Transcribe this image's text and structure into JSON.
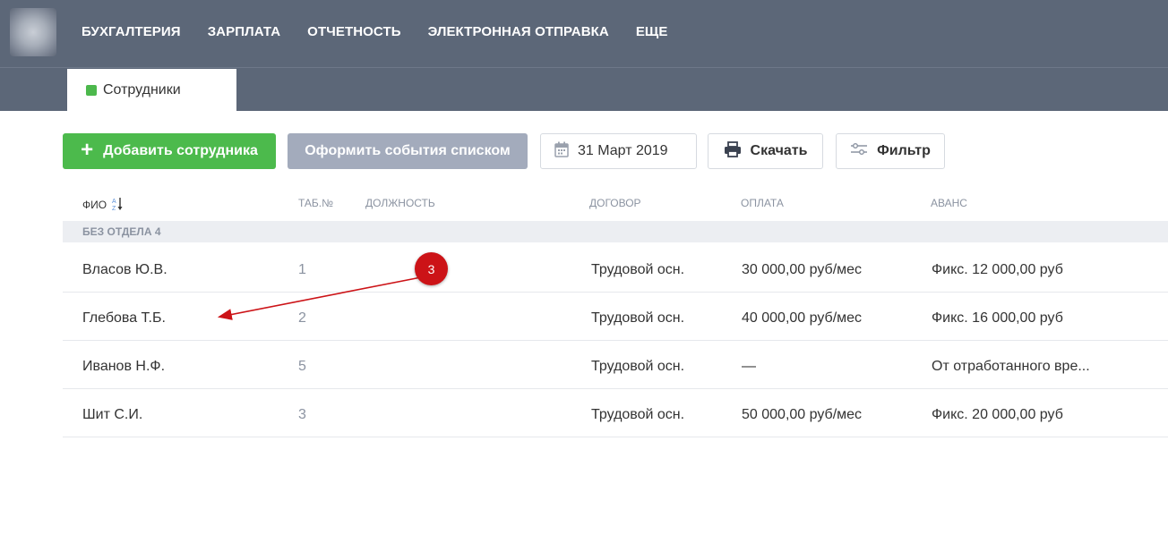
{
  "nav": {
    "items": [
      "БУХГАЛТЕРИЯ",
      "ЗАРПЛАТА",
      "ОТЧЕТНОСТЬ",
      "ЭЛЕКТРОННАЯ ОТПРАВКА",
      "ЕЩЕ"
    ]
  },
  "tab": {
    "label": "Сотрудники"
  },
  "toolbar": {
    "add_label": "Добавить сотрудника",
    "events_label": "Оформить события списком",
    "date_label": "31 Март 2019",
    "print_label": "Скачать",
    "filter_label": "Фильтр"
  },
  "columns": {
    "fio": "ФИО",
    "tab": "ТАБ.№",
    "position": "ДОЛЖНОСТЬ",
    "contract": "ДОГОВОР",
    "pay": "ОПЛАТА",
    "advance": "АВАНС"
  },
  "group": {
    "label": "БЕЗ ОТДЕЛА 4"
  },
  "rows": [
    {
      "name": "Власов Ю.В.",
      "tab": "1",
      "contract": "Трудовой осн.",
      "pay": "30 000,00 руб/мес",
      "advance": "Фикс. 12 000,00 руб"
    },
    {
      "name": "Глебова Т.Б.",
      "tab": "2",
      "contract": "Трудовой осн.",
      "pay": "40 000,00 руб/мес",
      "advance": "Фикс. 16 000,00 руб"
    },
    {
      "name": "Иванов Н.Ф.",
      "tab": "5",
      "contract": "Трудовой осн.",
      "pay": "—",
      "advance": "От отработанного вре..."
    },
    {
      "name": "Шит С.И.",
      "tab": "3",
      "contract": "Трудовой осн.",
      "pay": "50 000,00 руб/мес",
      "advance": "Фикс. 20 000,00 руб"
    }
  ],
  "annotation": {
    "badge": "3",
    "color": "#cc1317"
  },
  "colors": {
    "header": "#5c6778",
    "accent_green": "#4cba4c",
    "button_gray": "#a3abbc"
  },
  "icons": {
    "add": "plus-icon",
    "date": "calendar-icon",
    "print": "printer-icon",
    "filter": "sliders-icon",
    "sort": "sort-alpha-icon"
  }
}
